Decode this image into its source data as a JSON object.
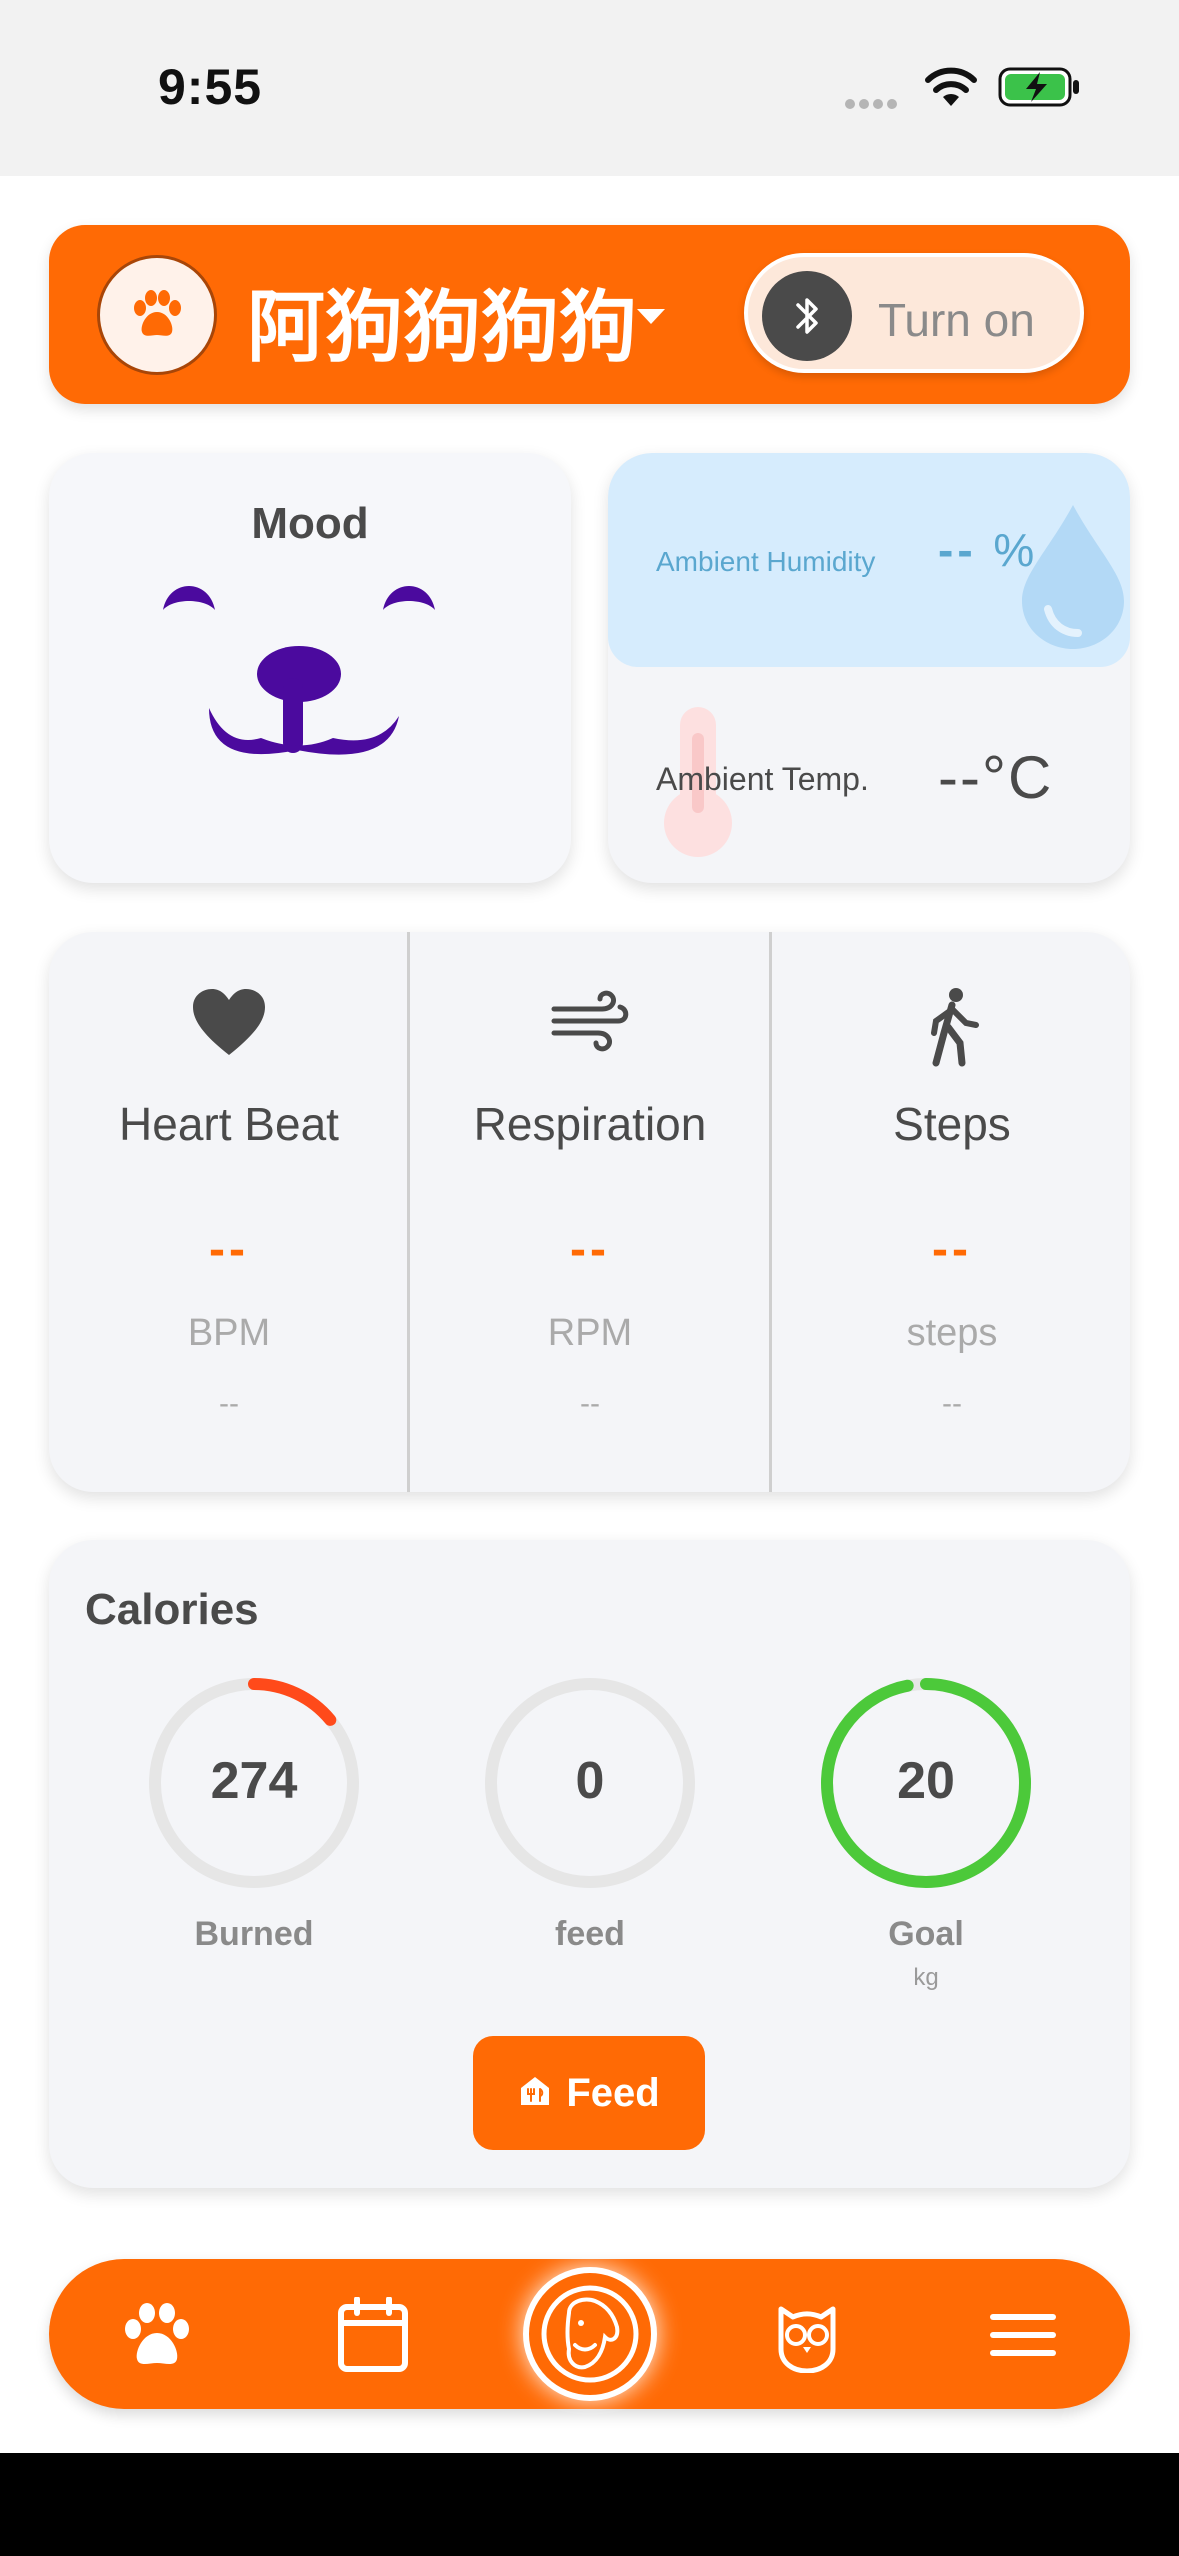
{
  "status_bar": {
    "time": "9:55"
  },
  "header": {
    "pet_name": "阿狗狗狗狗",
    "bluetooth_label": "Turn on"
  },
  "mood": {
    "title": "Mood"
  },
  "environment": {
    "humidity_label": "Ambient Humidity",
    "humidity_value": "--",
    "humidity_unit": "%",
    "temp_label": "Ambient Temp.",
    "temp_value": "--°C"
  },
  "vitals": [
    {
      "label": "Heart Beat",
      "value": "--",
      "unit": "BPM",
      "sub": "--"
    },
    {
      "label": "Respiration",
      "value": "--",
      "unit": "RPM",
      "sub": "--"
    },
    {
      "label": "Steps",
      "value": "--",
      "unit": "steps",
      "sub": "--"
    }
  ],
  "calories": {
    "title": "Calories",
    "burned": {
      "value": "274",
      "label": "Burned",
      "progress": 0.14
    },
    "feed": {
      "value": "0",
      "label": "feed",
      "progress": 0
    },
    "goal": {
      "value": "20",
      "label": "Goal",
      "unit": "kg",
      "progress": 0.97
    },
    "feed_button": "Feed"
  },
  "colors": {
    "accent": "#ff6a05",
    "mood_face": "#4b0a9e",
    "burned_ring": "#ff4a1a",
    "goal_ring": "#4cc93a",
    "humidity": "#5aa7cf"
  },
  "nav": {
    "items": [
      "paw-icon",
      "calendar-icon",
      "pet-face-icon",
      "owl-icon",
      "menu-icon"
    ]
  }
}
